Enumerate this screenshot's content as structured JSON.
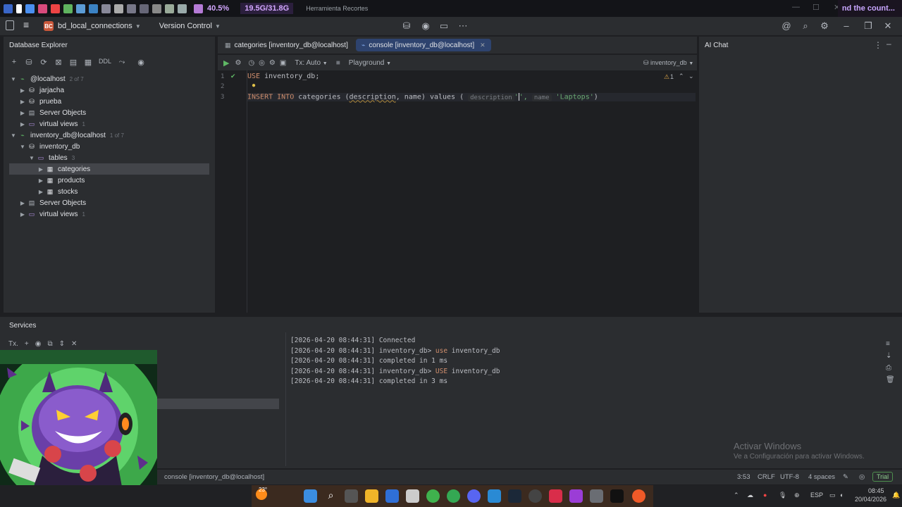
{
  "sysbar": {
    "cpu": "40.5%",
    "mem": "19.5G/31.8G",
    "snip_title": "Herramienta Recortes",
    "marquee": "nd the count..."
  },
  "header": {
    "project_badge": "BC",
    "project_name": "bd_local_connections",
    "vcs": "Version Control"
  },
  "db_explorer": {
    "title": "Database Explorer",
    "ddl": "DDL",
    "tree": [
      {
        "label": "@localhost",
        "count": "2 of 7",
        "level": 0,
        "icon": "connection-icon"
      },
      {
        "label": "jarjacha",
        "count": "",
        "level": 1,
        "icon": "schema-icon"
      },
      {
        "label": "prueba",
        "count": "",
        "level": 1,
        "icon": "schema-icon"
      },
      {
        "label": "Server Objects",
        "count": "",
        "level": 1,
        "icon": "server-objects-icon"
      },
      {
        "label": "virtual views",
        "count": "1",
        "level": 1,
        "icon": "folder-icon"
      },
      {
        "label": "inventory_db@localhost",
        "count": "1 of 7",
        "level": 0,
        "icon": "connection-icon"
      },
      {
        "label": "inventory_db",
        "count": "",
        "level": 1,
        "icon": "schema-icon"
      },
      {
        "label": "tables",
        "count": "3",
        "level": 2,
        "icon": "folder-icon"
      },
      {
        "label": "categories",
        "count": "",
        "level": 3,
        "icon": "table-icon"
      },
      {
        "label": "products",
        "count": "",
        "level": 3,
        "icon": "table-icon"
      },
      {
        "label": "stocks",
        "count": "",
        "level": 3,
        "icon": "table-icon"
      },
      {
        "label": "Server Objects",
        "count": "",
        "level": 1,
        "icon": "server-objects-icon"
      },
      {
        "label": "virtual views",
        "count": "1",
        "level": 1,
        "icon": "folder-icon"
      }
    ]
  },
  "editor": {
    "tabs": [
      {
        "label": "categories [inventory_db@localhost]",
        "active": false
      },
      {
        "label": "console [inventory_db@localhost]",
        "active": true
      }
    ],
    "tx": "Tx: Auto",
    "playground": "Playground",
    "schema": "inventory_db",
    "warnings": "1",
    "line_numbers": [
      "1",
      "2",
      "3"
    ],
    "line1": {
      "kw": "USE",
      "rest": " inventory_db;"
    },
    "line3": {
      "kw1": "INSERT INTO",
      "table": " categories (",
      "col1": "description",
      "comma": ", ",
      "col2": "name",
      "rp": ") ",
      "values_kw": "values",
      "lp": " ( ",
      "hint1": "description",
      "s1": "'",
      "sep": "', ",
      "hint2": "name",
      "s2": "'Laptops'",
      "end": ")"
    }
  },
  "ai_chat": {
    "title": "AI Chat"
  },
  "services": {
    "title": "Services",
    "tx": "Tx.",
    "log": [
      {
        "ts": "[2026-04-20 08:44:31]",
        "pre": " Connected",
        "kw": "",
        "post": ""
      },
      {
        "ts": "[2026-04-20 08:44:31]",
        "pre": " inventory_db> ",
        "kw": "use",
        "post": " inventory_db"
      },
      {
        "ts": "[2026-04-20 08:44:31]",
        "pre": " completed in 1 ms",
        "kw": "",
        "post": ""
      },
      {
        "ts": "[2026-04-20 08:44:31]",
        "pre": " inventory_db> ",
        "kw": "USE",
        "post": " inventory_db"
      },
      {
        "ts": "[2026-04-20 08:44:31]",
        "pre": " completed in 3 ms",
        "kw": "",
        "post": ""
      }
    ]
  },
  "watermark": {
    "line1": "Activar Windows",
    "line2": "Ve a Configuración para activar Windows."
  },
  "status": {
    "console": "console [inventory_db@localhost]",
    "pos": "3:53",
    "eol": "CRLF",
    "enc": "UTF-8",
    "indent": "4 spaces",
    "trial": "Trial"
  },
  "taskbar": {
    "weather": "23°",
    "lang": "ESP",
    "time": "08:45",
    "date": "20/04/2026"
  },
  "colors": {
    "accent": "#2e436e",
    "keyword": "#cf8e6d",
    "string": "#6aab73",
    "background": "#1e1f22",
    "panel": "#2b2d30"
  }
}
